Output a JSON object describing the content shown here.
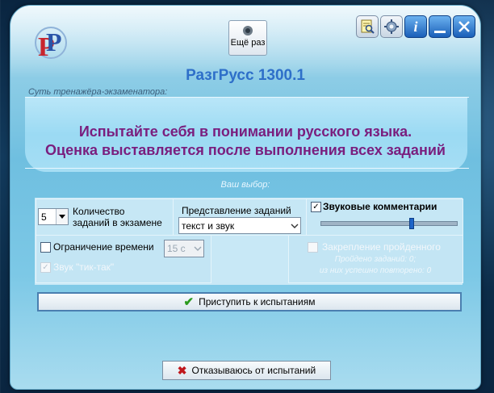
{
  "window": {
    "title": "РазгРусс 1300.1",
    "again_label": "Ещё раз"
  },
  "header": {
    "essence_label": "Суть тренажёра-экзаменатора:"
  },
  "main_text": {
    "line1": "Испытайте себя в понимании русского языка.",
    "line2": "Оценка выставляется после выполнения всех заданий"
  },
  "choice_label": "Ваш выбор:",
  "settings": {
    "count": {
      "label_line1": "Количество",
      "label_line2": "заданий в экзамене",
      "value": "5"
    },
    "presentation": {
      "label": "Представление заданий",
      "value": "текст и звук"
    },
    "sound_comments": {
      "label": "Звуковые комментарии",
      "checked": true,
      "volume_fraction": 0.65
    },
    "time_limit": {
      "label": "Ограничение времени",
      "checked": false,
      "value": "15 с"
    },
    "tick_sound": {
      "label": "Звук \"тик-так\"",
      "checked": true
    },
    "fixing": {
      "label": "Закрепление пройденного",
      "checked": false,
      "passed": "Пройдено заданий: 0;",
      "repeated": "из них успешно повторено: 0"
    }
  },
  "buttons": {
    "start": "Приступить к испытаниям",
    "refuse": "Отказываюсь от испытаний"
  },
  "colors": {
    "title": "#2e6fc9",
    "main_text": "#7a1e7e",
    "accent_blue": "#1a5fb8"
  }
}
